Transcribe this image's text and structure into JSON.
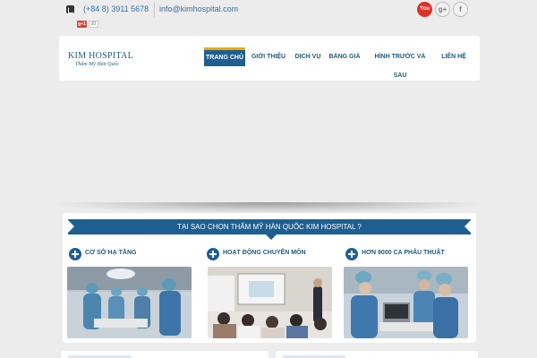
{
  "topbar": {
    "phone": "(+84 8) 3911 5678",
    "email": "info@kimhospital.com",
    "gplus_label": "g+1",
    "gplus_count": "20",
    "social": {
      "youtube": "You",
      "googleplus": "g+",
      "facebook": "f"
    }
  },
  "header": {
    "logo_main": "KIM HOSPITAL",
    "logo_sub": "Thẩm Mỹ Hàn Quốc",
    "nav": [
      "TRANG CHỦ",
      "GIỚI THIỆU",
      "DỊCH VỤ",
      "BẢNG GIÁ",
      "HÌNH TRƯỚC VÀ SAU",
      "LIÊN HỆ"
    ],
    "active_nav": "TRANG CHỦ"
  },
  "why": {
    "title": "TẠI SAO CHỌN THẨM MỸ HÀN QUỐC KIM HOSPITAL ?",
    "columns": [
      {
        "title": "CƠ SỞ HẠ TẦNG"
      },
      {
        "title": "HOẠT ĐỘNG CHUYÊN MÔN"
      },
      {
        "title": "HƠN 9000 CA PHẪU THUẬT"
      }
    ]
  },
  "colors": {
    "primary": "#1e5f91",
    "accent": "#f0a800",
    "link": "#3a6ea5",
    "youtube": "#d8322a"
  }
}
